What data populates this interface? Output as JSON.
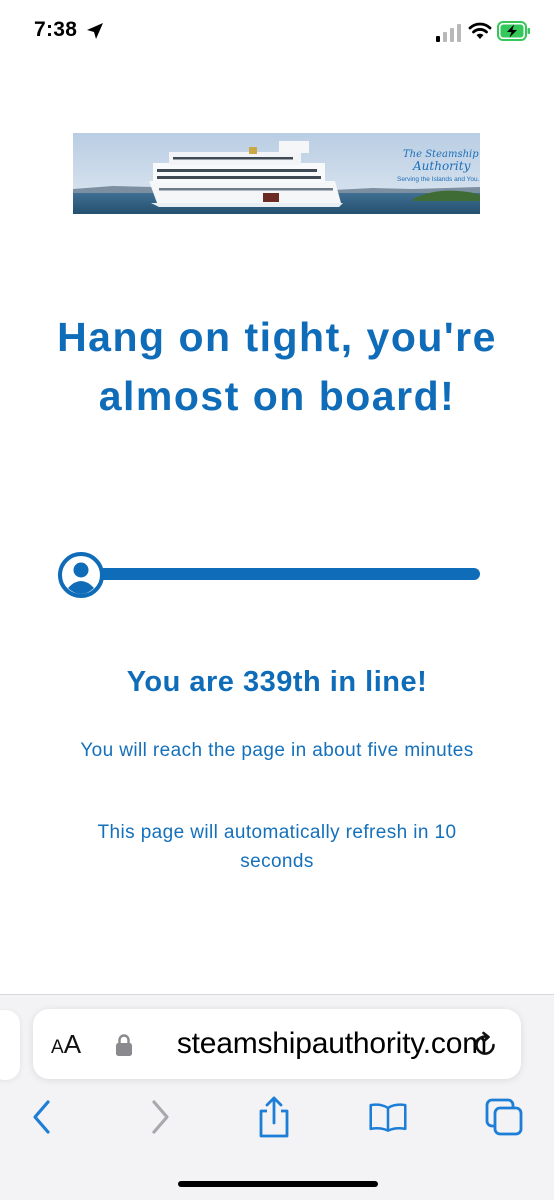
{
  "status_bar": {
    "time": "7:38"
  },
  "banner": {
    "logo_line1": "The Steamship",
    "logo_line2": "Authority",
    "tagline": "Serving the Islands and You."
  },
  "page": {
    "headline": "Hang on tight, you're almost on board!",
    "queue_position": "You are 339th in line!",
    "eta_message": "You will reach the page in about five minutes",
    "refresh_message": "This page will automatically refresh in 10 seconds",
    "progress_fraction": 0.0
  },
  "browser": {
    "aa_small": "A",
    "aa_large": "A",
    "url": "steamshipauthority.com"
  },
  "icons": {
    "location": "location-arrow-icon",
    "signal": "cellular-signal-icon",
    "wifi": "wifi-icon",
    "battery": "battery-charging-icon",
    "user": "user-avatar-icon",
    "lock": "lock-icon",
    "reload": "reload-icon",
    "back": "back-chevron-icon",
    "forward": "forward-chevron-icon",
    "share": "share-icon",
    "bookmarks": "book-icon",
    "tabs": "tabs-icon"
  },
  "colors": {
    "accent": "#0f6cb8",
    "battery": "#34c759"
  }
}
